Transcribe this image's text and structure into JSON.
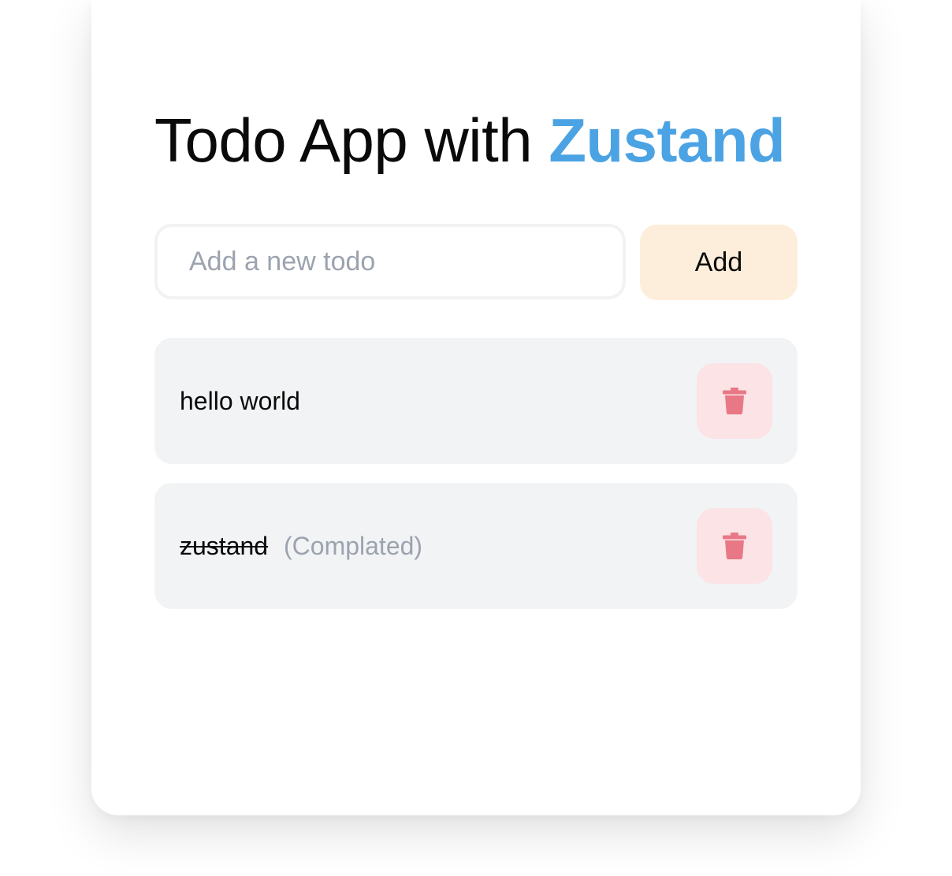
{
  "header": {
    "title_prefix": "Todo App with ",
    "title_brand": "Zustand"
  },
  "form": {
    "input_placeholder": "Add a new todo",
    "input_value": "",
    "add_label": "Add"
  },
  "todos": [
    {
      "text": "hello world",
      "completed": false,
      "status_label": ""
    },
    {
      "text": "zustand",
      "completed": true,
      "status_label": "(Complated)"
    }
  ],
  "icons": {
    "delete": "trash-icon"
  },
  "colors": {
    "brand": "#4ba3e3",
    "add_button_bg": "#fdeedb",
    "delete_button_bg": "#fbe3e6",
    "delete_icon": "#e87885",
    "item_bg": "#f2f3f5",
    "muted_text": "#9ca3af"
  }
}
